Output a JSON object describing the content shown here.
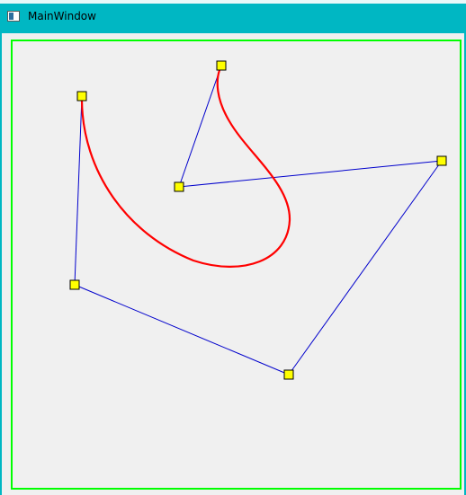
{
  "window": {
    "title": "MainWindow",
    "icon": "window-app-icon"
  },
  "canvas": {
    "frame_color": "#00ff00",
    "curve_color": "#ff0000",
    "control_line_color": "#0000cc",
    "handle_fill": "#ffff00",
    "handle_stroke": "#000000"
  }
}
